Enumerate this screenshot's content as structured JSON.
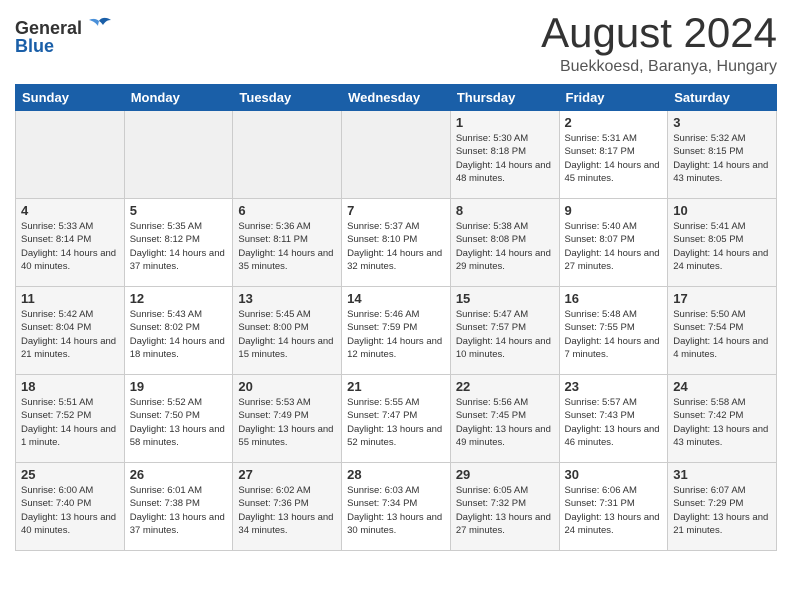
{
  "header": {
    "logo_general": "General",
    "logo_blue": "Blue",
    "month": "August 2024",
    "location": "Buekkoesd, Baranya, Hungary"
  },
  "weekdays": [
    "Sunday",
    "Monday",
    "Tuesday",
    "Wednesday",
    "Thursday",
    "Friday",
    "Saturday"
  ],
  "weeks": [
    [
      {
        "day": "",
        "empty": true
      },
      {
        "day": "",
        "empty": true
      },
      {
        "day": "",
        "empty": true
      },
      {
        "day": "",
        "empty": true
      },
      {
        "day": "1",
        "sunrise": "5:30 AM",
        "sunset": "8:18 PM",
        "daylight": "14 hours and 48 minutes."
      },
      {
        "day": "2",
        "sunrise": "5:31 AM",
        "sunset": "8:17 PM",
        "daylight": "14 hours and 45 minutes."
      },
      {
        "day": "3",
        "sunrise": "5:32 AM",
        "sunset": "8:15 PM",
        "daylight": "14 hours and 43 minutes."
      }
    ],
    [
      {
        "day": "4",
        "sunrise": "5:33 AM",
        "sunset": "8:14 PM",
        "daylight": "14 hours and 40 minutes."
      },
      {
        "day": "5",
        "sunrise": "5:35 AM",
        "sunset": "8:12 PM",
        "daylight": "14 hours and 37 minutes."
      },
      {
        "day": "6",
        "sunrise": "5:36 AM",
        "sunset": "8:11 PM",
        "daylight": "14 hours and 35 minutes."
      },
      {
        "day": "7",
        "sunrise": "5:37 AM",
        "sunset": "8:10 PM",
        "daylight": "14 hours and 32 minutes."
      },
      {
        "day": "8",
        "sunrise": "5:38 AM",
        "sunset": "8:08 PM",
        "daylight": "14 hours and 29 minutes."
      },
      {
        "day": "9",
        "sunrise": "5:40 AM",
        "sunset": "8:07 PM",
        "daylight": "14 hours and 27 minutes."
      },
      {
        "day": "10",
        "sunrise": "5:41 AM",
        "sunset": "8:05 PM",
        "daylight": "14 hours and 24 minutes."
      }
    ],
    [
      {
        "day": "11",
        "sunrise": "5:42 AM",
        "sunset": "8:04 PM",
        "daylight": "14 hours and 21 minutes."
      },
      {
        "day": "12",
        "sunrise": "5:43 AM",
        "sunset": "8:02 PM",
        "daylight": "14 hours and 18 minutes."
      },
      {
        "day": "13",
        "sunrise": "5:45 AM",
        "sunset": "8:00 PM",
        "daylight": "14 hours and 15 minutes."
      },
      {
        "day": "14",
        "sunrise": "5:46 AM",
        "sunset": "7:59 PM",
        "daylight": "14 hours and 12 minutes."
      },
      {
        "day": "15",
        "sunrise": "5:47 AM",
        "sunset": "7:57 PM",
        "daylight": "14 hours and 10 minutes."
      },
      {
        "day": "16",
        "sunrise": "5:48 AM",
        "sunset": "7:55 PM",
        "daylight": "14 hours and 7 minutes."
      },
      {
        "day": "17",
        "sunrise": "5:50 AM",
        "sunset": "7:54 PM",
        "daylight": "14 hours and 4 minutes."
      }
    ],
    [
      {
        "day": "18",
        "sunrise": "5:51 AM",
        "sunset": "7:52 PM",
        "daylight": "14 hours and 1 minute."
      },
      {
        "day": "19",
        "sunrise": "5:52 AM",
        "sunset": "7:50 PM",
        "daylight": "13 hours and 58 minutes."
      },
      {
        "day": "20",
        "sunrise": "5:53 AM",
        "sunset": "7:49 PM",
        "daylight": "13 hours and 55 minutes."
      },
      {
        "day": "21",
        "sunrise": "5:55 AM",
        "sunset": "7:47 PM",
        "daylight": "13 hours and 52 minutes."
      },
      {
        "day": "22",
        "sunrise": "5:56 AM",
        "sunset": "7:45 PM",
        "daylight": "13 hours and 49 minutes."
      },
      {
        "day": "23",
        "sunrise": "5:57 AM",
        "sunset": "7:43 PM",
        "daylight": "13 hours and 46 minutes."
      },
      {
        "day": "24",
        "sunrise": "5:58 AM",
        "sunset": "7:42 PM",
        "daylight": "13 hours and 43 minutes."
      }
    ],
    [
      {
        "day": "25",
        "sunrise": "6:00 AM",
        "sunset": "7:40 PM",
        "daylight": "13 hours and 40 minutes."
      },
      {
        "day": "26",
        "sunrise": "6:01 AM",
        "sunset": "7:38 PM",
        "daylight": "13 hours and 37 minutes."
      },
      {
        "day": "27",
        "sunrise": "6:02 AM",
        "sunset": "7:36 PM",
        "daylight": "13 hours and 34 minutes."
      },
      {
        "day": "28",
        "sunrise": "6:03 AM",
        "sunset": "7:34 PM",
        "daylight": "13 hours and 30 minutes."
      },
      {
        "day": "29",
        "sunrise": "6:05 AM",
        "sunset": "7:32 PM",
        "daylight": "13 hours and 27 minutes."
      },
      {
        "day": "30",
        "sunrise": "6:06 AM",
        "sunset": "7:31 PM",
        "daylight": "13 hours and 24 minutes."
      },
      {
        "day": "31",
        "sunrise": "6:07 AM",
        "sunset": "7:29 PM",
        "daylight": "13 hours and 21 minutes."
      }
    ]
  ]
}
